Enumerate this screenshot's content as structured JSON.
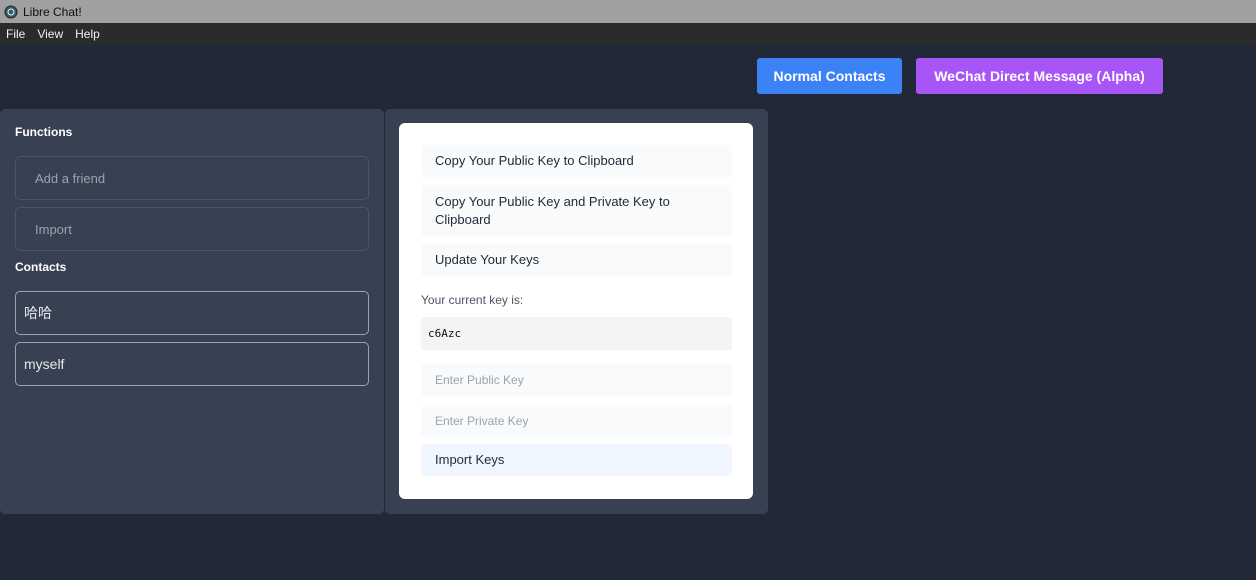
{
  "window": {
    "title": "Libre Chat!",
    "icon": "app-logo-icon"
  },
  "menubar": {
    "items": [
      "File",
      "View",
      "Help"
    ]
  },
  "top_buttons": {
    "normal_contacts": "Normal Contacts",
    "wechat_dm": "WeChat Direct Message (Alpha)"
  },
  "sidebar": {
    "functions_heading": "Functions",
    "functions": [
      "Add a friend",
      "Import"
    ],
    "contacts_heading": "Contacts",
    "contacts": [
      "哈哈",
      "myself"
    ]
  },
  "key_card": {
    "copy_public": "Copy Your Public Key to Clipboard",
    "copy_public_private": "Copy Your Public Key and Private Key to Clipboard",
    "update_keys": "Update Your Keys",
    "current_key_label": "Your current key is:",
    "current_key": "c6Azc",
    "public_key_placeholder": "Enter Public Key",
    "private_key_placeholder": "Enter Private Key",
    "import_keys": "Import Keys"
  },
  "colors": {
    "background": "#212838",
    "panel": "#374151",
    "normal_contacts_button": "#3b82f6",
    "wechat_button": "#a855f7"
  }
}
